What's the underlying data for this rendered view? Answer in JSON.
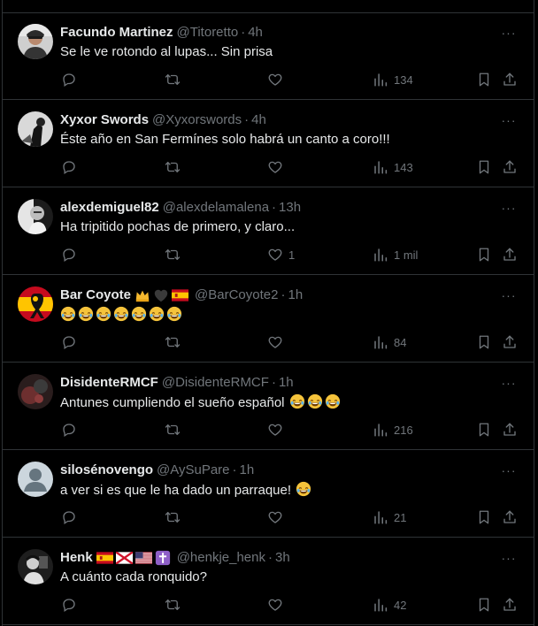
{
  "tweets": [
    {
      "name": "Facundo Martinez",
      "handle": "@Titoretto",
      "sep": "·",
      "time": "4h",
      "text": "Se le ve rotondo al lupas... Sin prisa",
      "text_emojis": 0,
      "reply_count": "",
      "retweet_count": "",
      "like_count": "",
      "views": "134",
      "badges": [],
      "avatar": "person"
    },
    {
      "name": "Xyxor Swords",
      "handle": "@Xyxorswords",
      "sep": "·",
      "time": "4h",
      "text": "Éste año en San Fermínes solo habrá un canto a coro!!!",
      "text_emojis": 0,
      "reply_count": "",
      "retweet_count": "",
      "like_count": "",
      "views": "143",
      "badges": [],
      "avatar": "bw"
    },
    {
      "name": "alexdemiguel82",
      "handle": "@alexdelamalena",
      "sep": "·",
      "time": "13h",
      "text": "Ha tripitido pochas de primero, y claro...",
      "text_emojis": 0,
      "reply_count": "",
      "retweet_count": "",
      "like_count": "1",
      "views": "1 mil",
      "badges": [],
      "avatar": "bw2"
    },
    {
      "name": "Bar Coyote",
      "handle": "@BarCoyote2",
      "sep": "·",
      "time": "1h",
      "text": "",
      "text_emojis": 7,
      "reply_count": "",
      "retweet_count": "",
      "like_count": "",
      "views": "84",
      "badges": [
        "crown-emoji",
        "black-heart-emoji",
        "spain-flag-emoji"
      ],
      "avatar": "spain-ribbon"
    },
    {
      "name": "DisidenteRMCF",
      "handle": "@DisidenteRMCF",
      "sep": "·",
      "time": "1h",
      "text": "Antunes cumpliendo el sueño español",
      "text_emojis": 3,
      "reply_count": "",
      "retweet_count": "",
      "like_count": "",
      "views": "216",
      "badges": [],
      "avatar": "dark"
    },
    {
      "name": "silosénovengo",
      "handle": "@AySuPare",
      "sep": "·",
      "time": "1h",
      "text": "a ver si es que le ha dado un parraque!",
      "text_emojis": 1,
      "reply_count": "",
      "retweet_count": "",
      "like_count": "",
      "views": "21",
      "badges": [],
      "avatar": "default"
    },
    {
      "name": "Henk",
      "handle": "@henkje_henk",
      "sep": "·",
      "time": "3h",
      "text": "A cuánto cada ronquido?",
      "text_emojis": 0,
      "reply_count": "",
      "retweet_count": "",
      "like_count": "",
      "views": "42",
      "badges": [
        "spain-flag-emoji",
        "jersey-flag-emoji",
        "us-flag-emoji",
        "latin-cross-emoji"
      ],
      "avatar": "bw3"
    }
  ],
  "more_label": "···",
  "icons": [
    "reply-icon",
    "retweet-icon",
    "like-icon",
    "views-icon",
    "bookmark-icon",
    "share-icon"
  ]
}
